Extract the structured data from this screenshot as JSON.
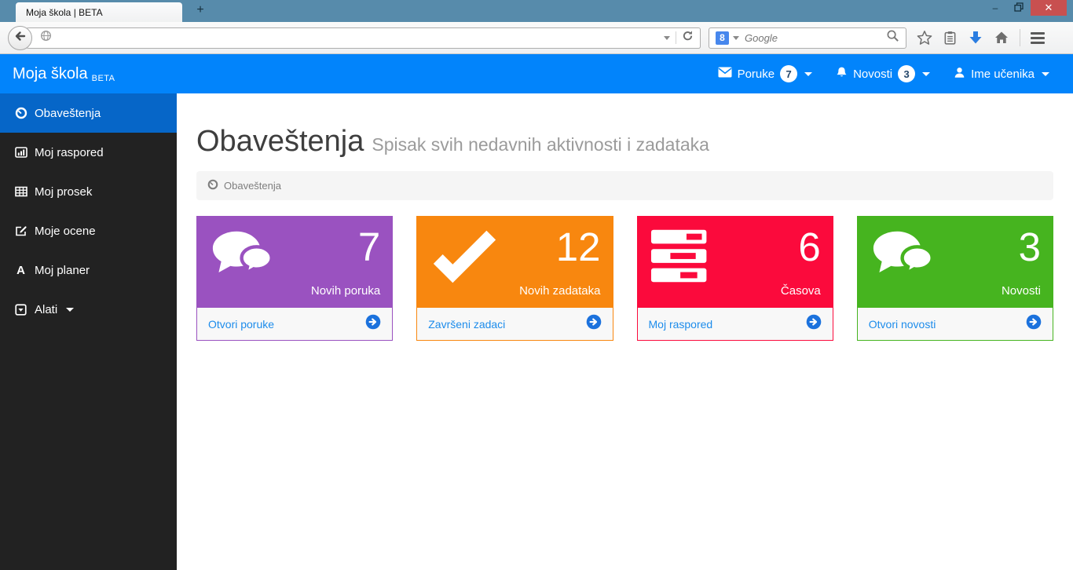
{
  "window": {
    "minimize_glyph": "–",
    "close_glyph": "✕"
  },
  "browser": {
    "tab_title": "Moja škola | BETA",
    "new_tab_label": "+",
    "url_value": "",
    "search_placeholder": "Google"
  },
  "navbar": {
    "brand": "Moja škola",
    "brand_badge": "BETA",
    "messages": {
      "label": "Poruke",
      "count": "7",
      "icon": "envelope-icon"
    },
    "news": {
      "label": "Novosti",
      "count": "3",
      "icon": "bell-icon"
    },
    "user": {
      "label": "Ime učenika",
      "icon": "user-icon"
    }
  },
  "sidebar": {
    "items": [
      {
        "label": "Obaveštenja",
        "icon": "gauge-icon",
        "active": true
      },
      {
        "label": "Moj raspored",
        "icon": "bar-chart-icon",
        "active": false
      },
      {
        "label": "Moj prosek",
        "icon": "table-icon",
        "active": false
      },
      {
        "label": "Moje ocene",
        "icon": "edit-icon",
        "active": false
      },
      {
        "label": "Moj planer",
        "icon": "font-icon",
        "icon_glyph": "A",
        "active": false
      },
      {
        "label": "Alati",
        "icon": "caret-square-down-icon",
        "active": false
      }
    ]
  },
  "main": {
    "title": "Obaveštenja",
    "subtitle": "Spisak svih nedavnih aktivnosti i zadataka",
    "breadcrumb": "Obaveštenja"
  },
  "cards": [
    {
      "count": "7",
      "label": "Novih poruka",
      "link": "Otvori poruke",
      "icon": "comments-icon",
      "color": "#9a52c0"
    },
    {
      "count": "12",
      "label": "Novih zadataka",
      "link": "Završeni zadaci",
      "icon": "check-icon",
      "color": "#f8870f"
    },
    {
      "count": "6",
      "label": "Časova",
      "link": "Moj raspored",
      "icon": "tasks-icon",
      "color": "#fb0a3c"
    },
    {
      "count": "3",
      "label": "Novosti",
      "link": "Otvori novosti",
      "icon": "comments-icon",
      "color": "#46b41f"
    }
  ],
  "colors": {
    "titlebar": "#578bab",
    "close_red": "#c85050",
    "navbar_blue": "#0284fb",
    "sidebar_dark": "#222222",
    "sidebar_active_blue": "#0666c8",
    "link_blue": "#1d8ceb",
    "breadcrumb_bg": "#f5f5f5",
    "download_blue": "#2a7de1"
  }
}
